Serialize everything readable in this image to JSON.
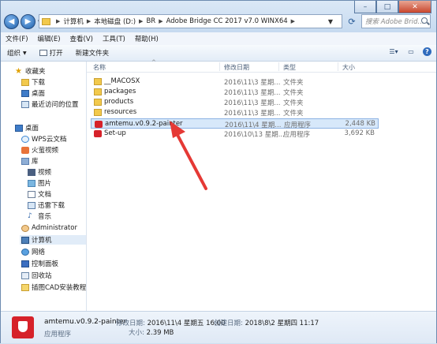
{
  "address": {
    "crumbs": [
      "计算机",
      "本地磁盘 (D:)",
      "BR",
      "Adobe Bridge CC 2017 v7.0 WINX64"
    ],
    "search_placeholder": "搜索 Adobe Brid..."
  },
  "menubar": [
    "文件(F)",
    "编辑(E)",
    "查看(V)",
    "工具(T)",
    "帮助(H)"
  ],
  "toolbar": {
    "organize": "组织",
    "print": "打开",
    "new_folder": "新建文件夹"
  },
  "nav": {
    "favorites": "收藏夹",
    "favorites_items": [
      "下载",
      "桌面",
      "最近访问的位置"
    ],
    "desktop": "桌面",
    "desktop_items": [
      "WPS云文档",
      "火萤视频",
      "库"
    ],
    "library_items": [
      "视频",
      "图片",
      "文档",
      "迅雷下载",
      "音乐"
    ],
    "other_items": [
      "Administrator",
      "计算机",
      "网络",
      "控制面板",
      "回收站",
      "插图CAD安装教程"
    ]
  },
  "columns": {
    "name": "名称",
    "date": "修改日期",
    "type": "类型",
    "size": "大小"
  },
  "files": [
    {
      "name": "__MACOSX",
      "date": "2016\\11\\3 星期...",
      "type": "文件夹",
      "size": "",
      "icon": "folder-icon"
    },
    {
      "name": "packages",
      "date": "2016\\11\\3 星期...",
      "type": "文件夹",
      "size": "",
      "icon": "folder-icon"
    },
    {
      "name": "products",
      "date": "2016\\11\\3 星期...",
      "type": "文件夹",
      "size": "",
      "icon": "folder-icon"
    },
    {
      "name": "resources",
      "date": "2016\\11\\3 星期...",
      "type": "文件夹",
      "size": "",
      "icon": "folder-icon"
    },
    {
      "name": "amtemu.v0.9.2-painter",
      "date": "2016\\11\\4 星期...",
      "type": "应用程序",
      "size": "2,448 KB",
      "icon": "app-icon"
    },
    {
      "name": "Set-up",
      "date": "2016\\10\\13 星期...",
      "type": "应用程序",
      "size": "3,692 KB",
      "icon": "app-icon"
    }
  ],
  "details": {
    "name": "amtemu.v0.9.2-painter",
    "type": "应用程序",
    "modified_label": "修改日期:",
    "modified_value": "2016\\11\\4 星期五 16:00",
    "created_label": "创建日期:",
    "created_value": "2018\\8\\2 星期四 11:17",
    "size_label": "大小:",
    "size_value": "2.39 MB"
  },
  "colors": {
    "arrow": "#e53935",
    "selection": "#d7e8fa",
    "accent": "#2f6bbd"
  }
}
